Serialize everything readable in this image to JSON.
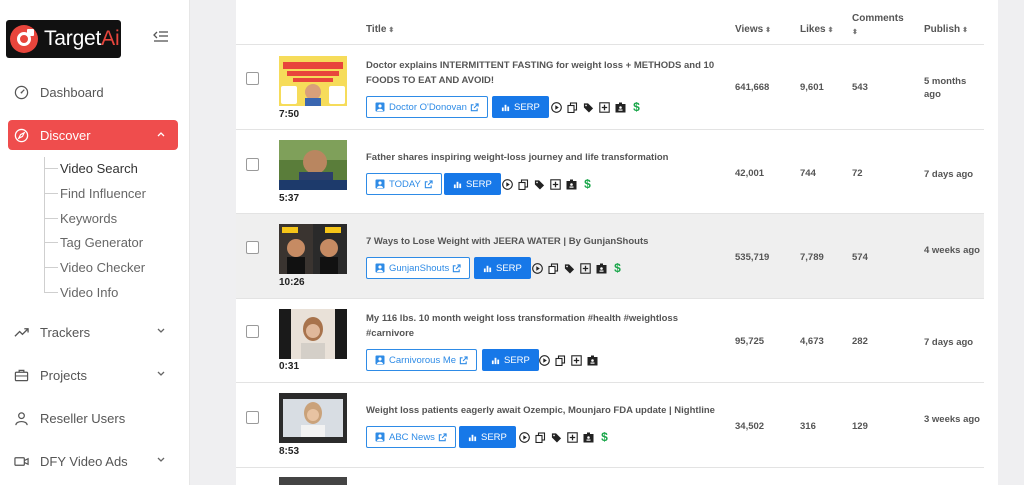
{
  "app": {
    "logo_main": "Target",
    "logo_accent": "Ai"
  },
  "sidebar": {
    "items": [
      {
        "label": "Dashboard",
        "icon": "speedometer-icon"
      },
      {
        "label": "Discover",
        "icon": "compass-icon",
        "active": true
      },
      {
        "label": "Trackers",
        "icon": "trending-up-icon"
      },
      {
        "label": "Projects",
        "icon": "briefcase-icon"
      },
      {
        "label": "Reseller Users",
        "icon": "user-icon"
      },
      {
        "label": "DFY Video Ads",
        "icon": "video-camera-icon"
      }
    ],
    "discover_sub": [
      "Video Search",
      "Find Influencer",
      "Keywords",
      "Tag Generator",
      "Video Checker",
      "Video Info"
    ]
  },
  "table": {
    "headers": {
      "title": "Title",
      "views": "Views",
      "likes": "Likes",
      "comments": "Comments",
      "publish": "Publish"
    },
    "sort_icon": "⬍",
    "serp_label": "SERP",
    "rows": [
      {
        "title": "Doctor explains INTERMITTENT FASTING for weight loss + METHODS and 10 FOODS TO EAT AND AVOID!",
        "thumb_text": "INTERMITTENT FASTING FOR WEIGHT LOSS",
        "duration": "7:50",
        "channel": "Doctor O'Donovan",
        "views": "641,668",
        "likes": "9,601",
        "comments": "543",
        "publish": "5 months ago",
        "has_dollar": true
      },
      {
        "title": "Father shares inspiring weight-loss journey and life transformation",
        "thumb_text": "",
        "duration": "5:37",
        "channel": "TODAY",
        "views": "42,001",
        "likes": "744",
        "comments": "72",
        "publish": "7 days ago",
        "has_dollar": true
      },
      {
        "title": "7 Ways to Lose Weight with JEERA WATER | By GunjanShouts",
        "thumb_text": "DAY 1",
        "duration": "10:26",
        "channel": "GunjanShouts",
        "views": "535,719",
        "likes": "7,789",
        "comments": "574",
        "publish": "4 weeks ago",
        "has_dollar": true
      },
      {
        "title": "My 116 lbs. 10 month weight loss transformation #health #weightloss #carnivore",
        "thumb_text": "",
        "duration": "0:31",
        "channel": "Carnivorous Me",
        "views": "95,725",
        "likes": "4,673",
        "comments": "282",
        "publish": "7 days ago",
        "has_dollar": false
      },
      {
        "title": "Weight loss patients eagerly await Ozempic, Mounjaro FDA update | Nightline",
        "thumb_text": "",
        "duration": "8:53",
        "channel": "ABC News",
        "views": "34,502",
        "likes": "316",
        "comments": "129",
        "publish": "3 weeks ago",
        "has_dollar": true
      }
    ]
  },
  "colors": {
    "accent_red": "#ef4d4d",
    "serp_blue": "#1778e8",
    "channel_blue": "#2e8be6",
    "dollar_green": "#1aa64a"
  }
}
